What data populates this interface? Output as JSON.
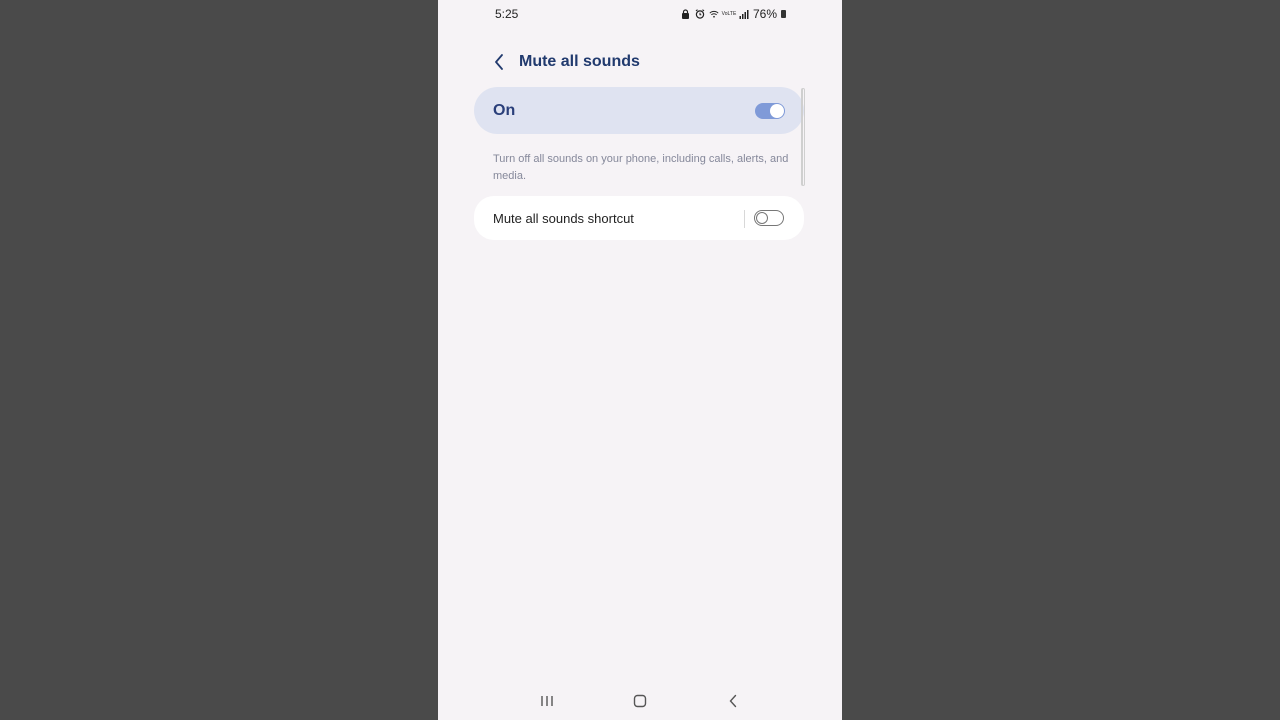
{
  "status_bar": {
    "time": "5:25",
    "battery_percent": "76%",
    "icons": [
      "lock-icon",
      "alarm-icon",
      "wifi-icon",
      "volte-icon",
      "signal-icon",
      "battery-icon"
    ],
    "volte_text": "VoLTE"
  },
  "header": {
    "title": "Mute all sounds",
    "back_icon": "chevron-left-icon"
  },
  "master_switch": {
    "label": "On",
    "state": true
  },
  "description": "Turn off all sounds on your phone, including calls, alerts, and media.",
  "shortcut": {
    "label": "Mute all sounds shortcut",
    "state": false
  },
  "colors": {
    "title": "#213a6e",
    "card_on": "#dfe3f1",
    "toggle_on": "#7f9ad8",
    "background": "#f6f3f6"
  },
  "navigation_bar": {
    "recents_icon": "recents-icon",
    "home_icon": "home-icon",
    "back_icon": "back-icon"
  }
}
